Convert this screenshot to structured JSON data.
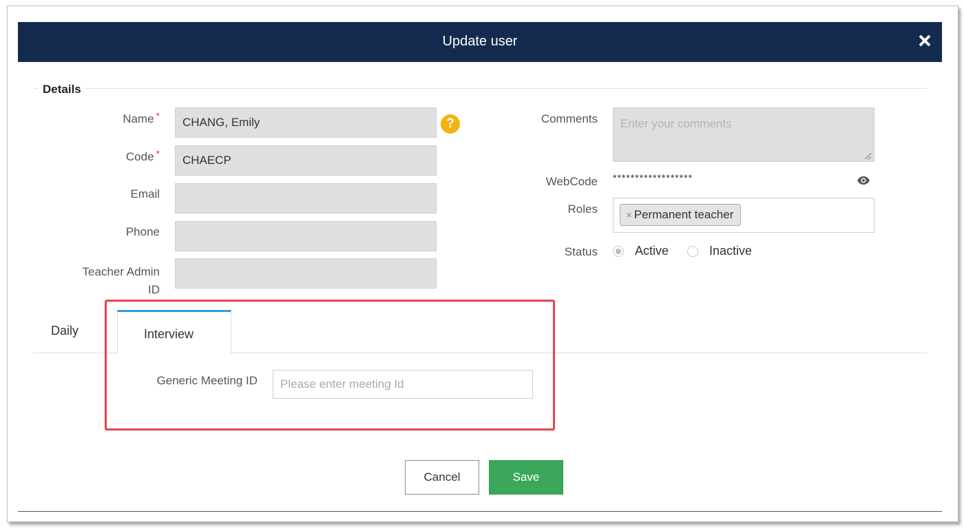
{
  "dialog": {
    "title": "Update user",
    "close_icon": "close-icon"
  },
  "details": {
    "legend": "Details",
    "name_label": "Name",
    "name_value": "CHANG, Emily",
    "code_label": "Code",
    "code_value": "CHAECP",
    "required_mark": "*",
    "email_label": "Email",
    "email_value": "",
    "phone_label": "Phone",
    "phone_value": "",
    "teacher_admin_label_line1": "Teacher Admin",
    "teacher_admin_label_line2": "ID",
    "teacher_admin_value": "",
    "help_glyph": "?",
    "comments_label": "Comments",
    "comments_placeholder": "Enter your comments",
    "webcode_label": "WebCode",
    "webcode_value": "******************",
    "roles_label": "Roles",
    "roles": [
      {
        "remove": "×",
        "label": "Permanent teacher"
      }
    ],
    "status_label": "Status",
    "status_options": [
      "Active",
      "Inactive"
    ],
    "status_selected": "Active"
  },
  "tabs": [
    {
      "label": "Daily",
      "active": false
    },
    {
      "label": "Interview",
      "active": true
    }
  ],
  "interview": {
    "meeting_label": "Generic Meeting ID",
    "meeting_placeholder": "Please enter meeting Id",
    "meeting_value": ""
  },
  "footer": {
    "cancel_label": "Cancel",
    "save_label": "Save"
  },
  "colors": {
    "titlebar": "#142a4f",
    "save_button": "#3aa75a",
    "active_tab_accent": "#2a9fe0",
    "highlight_box": "#e8434f",
    "help_icon": "#f1b40f",
    "required": "#e53935"
  }
}
